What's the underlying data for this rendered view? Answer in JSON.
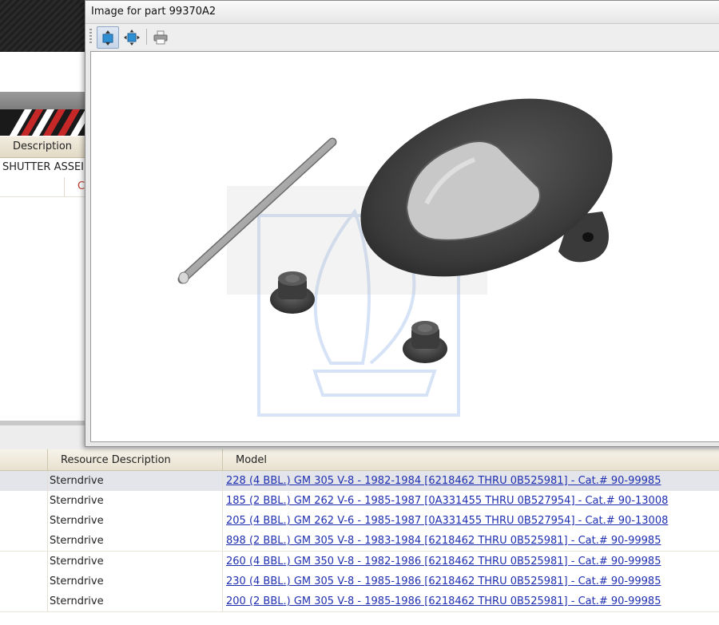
{
  "dialog": {
    "title": "Image for part 99370A2",
    "toolbar": {
      "fit_icon": "fit-to-window-icon",
      "actual_size_icon": "actual-size-icon",
      "print_icon": "print-icon"
    }
  },
  "background": {
    "description_header": "Description",
    "description_value": "SHUTTER ASSEI",
    "row2_value": "C"
  },
  "grid": {
    "columns": [
      "Resource Description",
      "Model"
    ],
    "rows": [
      {
        "resource": "Sterndrive",
        "model": "228 (4 BBL.) GM 305 V-8 - 1982-1984 [6218462 THRU 0B525981] - Cat.# 90-99985",
        "selected": true
      },
      {
        "resource": "Sterndrive",
        "model": "185 (2 BBL.) GM 262 V-6 - 1985-1987 [0A331455 THRU 0B527954] - Cat.# 90-13008",
        "selected": false
      },
      {
        "resource": "Sterndrive",
        "model": "205 (4 BBL.) GM 262 V-6 - 1985-1987 [0A331455 THRU 0B527954] - Cat.# 90-13008",
        "selected": false
      },
      {
        "resource": "Sterndrive",
        "model": "898 (2 BBL.) GM 305 V-8 - 1983-1984 [6218462 THRU 0B525981] - Cat.# 90-99985",
        "selected": false
      },
      {
        "resource": "Sterndrive",
        "model": "260 (4 BBL.) GM 350 V-8 - 1982-1986 [6218462 THRU 0B525981] - Cat.# 90-99985",
        "selected": false
      },
      {
        "resource": "Sterndrive",
        "model": "230 (4 BBL.) GM 305 V-8 - 1985-1986 [6218462 THRU 0B525981] - Cat.# 90-99985",
        "selected": false
      },
      {
        "resource": "Sterndrive",
        "model": "200 (2 BBL.) GM 305 V-8 - 1985-1986 [6218462 THRU 0B525981] - Cat.# 90-99985",
        "selected": false
      }
    ]
  },
  "colors": {
    "link": "#1f2fb0",
    "selected_row": "#e4e5ea",
    "header_bg": "#e8e1cf"
  }
}
